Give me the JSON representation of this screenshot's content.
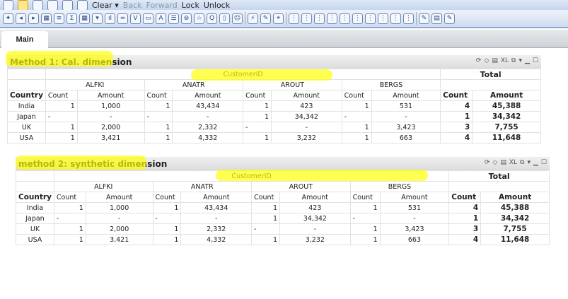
{
  "toolbar": {
    "clear": "Clear ▾",
    "back": "Back",
    "forward": "Forward",
    "lock": "Lock",
    "unlock": "Unlock"
  },
  "tabs": [
    {
      "label": "Main"
    }
  ],
  "tables": [
    {
      "title": "Method 1: Cal. dimension",
      "dimension": "CustomerID",
      "total": "Total",
      "row_header": "Country",
      "count": "Count",
      "amount": "Amount",
      "customers": [
        "ALFKI",
        "ANATR",
        "AROUT",
        "BERGS"
      ],
      "rows": [
        {
          "country": "India",
          "cells": [
            [
              "1",
              "1,000"
            ],
            [
              "1",
              "43,434"
            ],
            [
              "1",
              "423"
            ],
            [
              "1",
              "531"
            ]
          ],
          "total": [
            "4",
            "45,388"
          ]
        },
        {
          "country": "Japan",
          "cells": [
            [
              "-",
              "-"
            ],
            [
              "-",
              "-"
            ],
            [
              "1",
              "34,342"
            ],
            [
              "-",
              "-"
            ]
          ],
          "total": [
            "1",
            "34,342"
          ]
        },
        {
          "country": "UK",
          "cells": [
            [
              "1",
              "2,000"
            ],
            [
              "1",
              "2,332"
            ],
            [
              "-",
              "-"
            ],
            [
              "1",
              "3,423"
            ]
          ],
          "total": [
            "3",
            "7,755"
          ]
        },
        {
          "country": "USA",
          "cells": [
            [
              "1",
              "3,421"
            ],
            [
              "1",
              "4,332"
            ],
            [
              "1",
              "3,232"
            ],
            [
              "1",
              "663"
            ]
          ],
          "total": [
            "4",
            "11,648"
          ]
        }
      ]
    },
    {
      "title": "method 2: synthetic dimension",
      "dimension": "CustomerID",
      "total": "Total",
      "row_header": "Country",
      "count": "Count",
      "amount": "Amount",
      "customers": [
        "ALFKI",
        "ANATR",
        "AROUT",
        "BERGS"
      ],
      "rows": [
        {
          "country": "India",
          "cells": [
            [
              "1",
              "1,000"
            ],
            [
              "1",
              "43,434"
            ],
            [
              "1",
              "423"
            ],
            [
              "1",
              "531"
            ]
          ],
          "total": [
            "4",
            "45,388"
          ]
        },
        {
          "country": "Japan",
          "cells": [
            [
              "-",
              "-"
            ],
            [
              "-",
              "-"
            ],
            [
              "1",
              "34,342"
            ],
            [
              "-",
              "-"
            ]
          ],
          "total": [
            "1",
            "34,342"
          ]
        },
        {
          "country": "UK",
          "cells": [
            [
              "1",
              "2,000"
            ],
            [
              "1",
              "2,332"
            ],
            [
              "-",
              "-"
            ],
            [
              "1",
              "3,423"
            ]
          ],
          "total": [
            "3",
            "7,755"
          ]
        },
        {
          "country": "USA",
          "cells": [
            [
              "1",
              "3,421"
            ],
            [
              "1",
              "4,332"
            ],
            [
              "1",
              "3,232"
            ],
            [
              "1",
              "663"
            ]
          ],
          "total": [
            "4",
            "11,648"
          ]
        }
      ]
    }
  ]
}
